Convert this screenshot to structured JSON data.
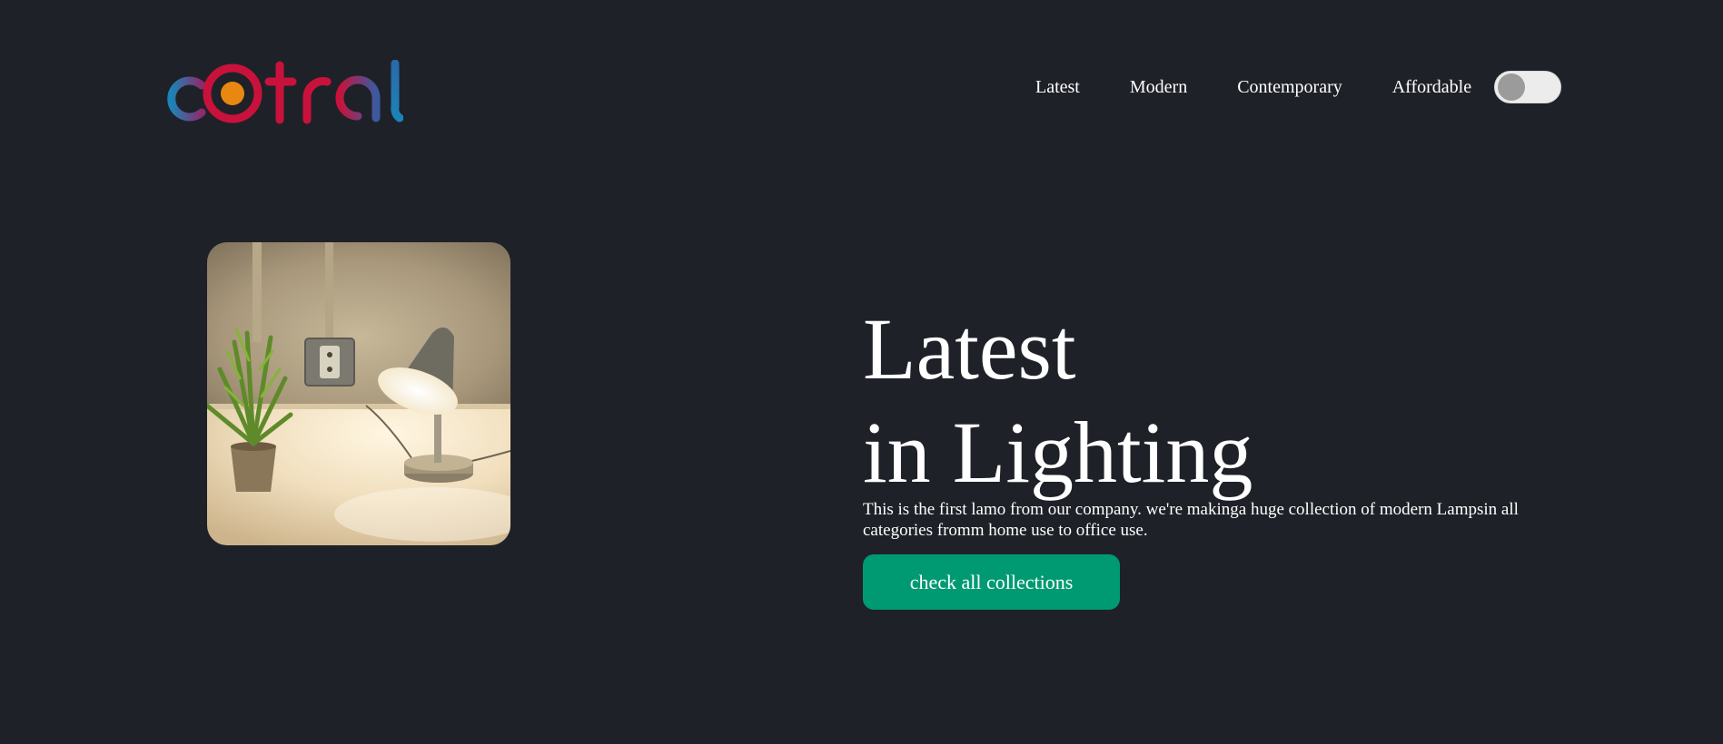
{
  "brand": {
    "logo_text": "cotral",
    "colors": {
      "blue": "#1b83b8",
      "crimson": "#c8123c",
      "orange": "#e88712"
    }
  },
  "nav": {
    "items": [
      {
        "label": "Latest"
      },
      {
        "label": "Modern"
      },
      {
        "label": "Contemporary"
      },
      {
        "label": "Affordable"
      }
    ],
    "theme_toggle": {
      "state": "off"
    }
  },
  "hero": {
    "image_alt": "Desk lamp and potted plant on a white desk",
    "title_line1": "Latest",
    "title_line2": "in Lighting",
    "description": "This is the first lamo from our company. we're makinga huge collection of modern Lampsin all categories fromm home use to office use.",
    "cta_label": "check all collections"
  },
  "colors": {
    "background": "#1f2128",
    "accent": "#009a72",
    "text": "#ffffff"
  }
}
